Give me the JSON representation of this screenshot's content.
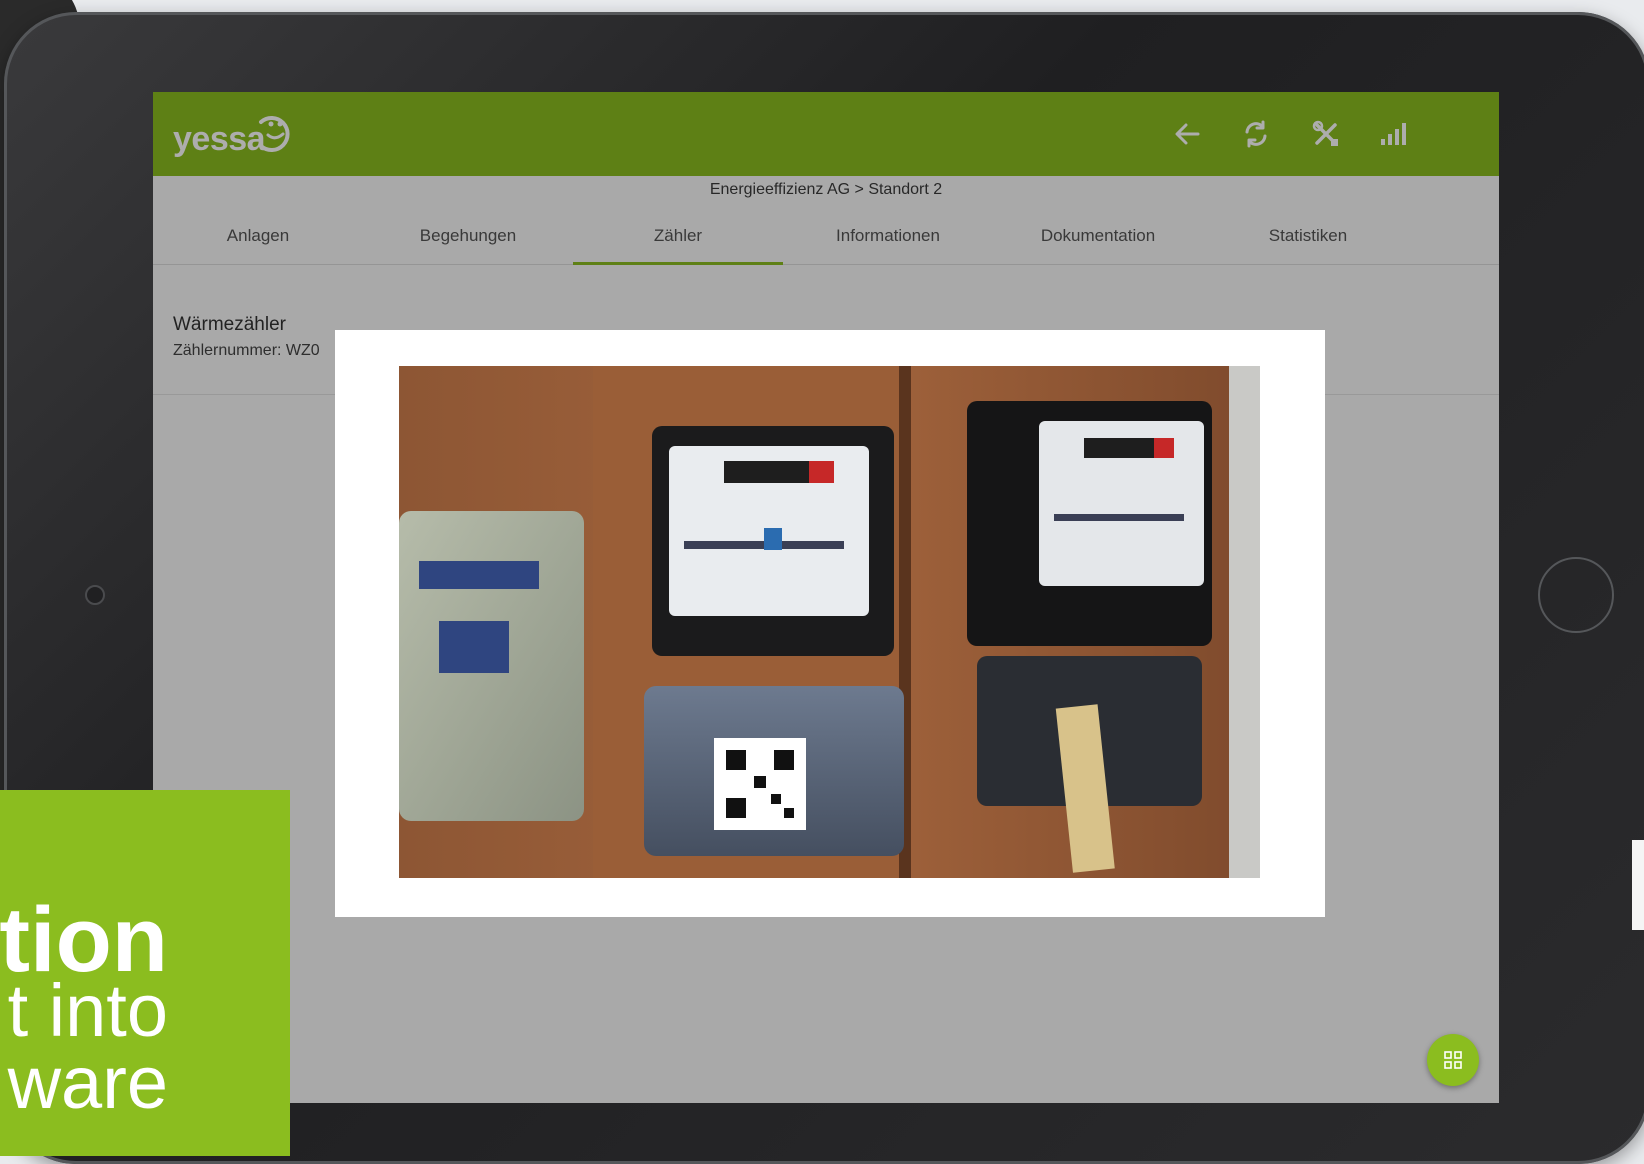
{
  "app": {
    "logo_text": "yessa",
    "brand_color": "#8bbd1f"
  },
  "topbar": {
    "icons": [
      "back-arrow-icon",
      "refresh-icon",
      "tools-icon",
      "signal-icon"
    ]
  },
  "breadcrumb": "Energieeffizienz AG > Standort 2",
  "tabs": [
    {
      "label": "Anlagen",
      "active": false
    },
    {
      "label": "Begehungen",
      "active": false
    },
    {
      "label": "Zähler",
      "active": true
    },
    {
      "label": "Informationen",
      "active": false
    },
    {
      "label": "Dokumentation",
      "active": false
    },
    {
      "label": "Statistiken",
      "active": false
    }
  ],
  "meter": {
    "title": "Wärmezähler",
    "number_label": "Zählernummer: WZ0"
  },
  "dialog": {
    "image_desc": "meter-photo"
  },
  "promo": {
    "line1": "tion",
    "line2": "t into",
    "line3": "ware"
  }
}
